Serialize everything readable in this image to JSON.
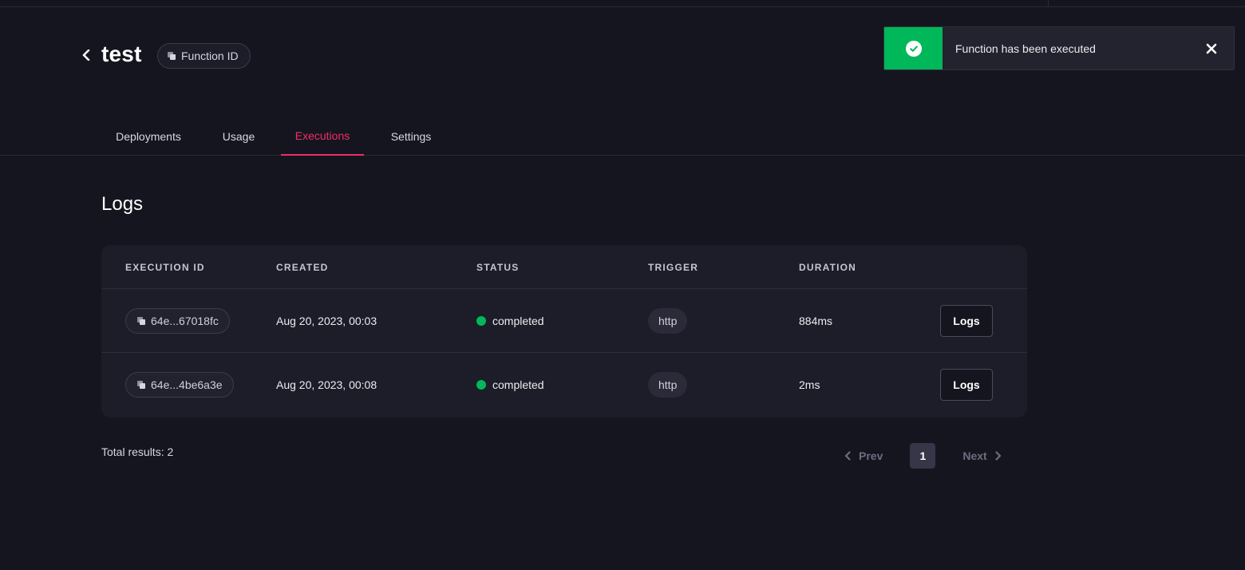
{
  "header": {
    "back_icon": "chevron-left-icon",
    "title": "test",
    "id_pill_label": "Function ID"
  },
  "toast": {
    "message": "Function has been executed",
    "status_color": "#00b85a",
    "icon": "check-circle-icon",
    "close_icon": "close-icon"
  },
  "tabs": [
    {
      "label": "Deployments",
      "active": false
    },
    {
      "label": "Usage",
      "active": false
    },
    {
      "label": "Executions",
      "active": true
    },
    {
      "label": "Settings",
      "active": false
    }
  ],
  "accent_color": "#f02e65",
  "section": {
    "title": "Logs"
  },
  "table": {
    "columns": [
      "EXECUTION ID",
      "CREATED",
      "STATUS",
      "TRIGGER",
      "DURATION"
    ],
    "rows": [
      {
        "execution_id": "64e...67018fc",
        "created": "Aug 20, 2023, 00:03",
        "status": "completed",
        "trigger": "http",
        "duration": "884ms",
        "action": "Logs"
      },
      {
        "execution_id": "64e...4be6a3e",
        "created": "Aug 20, 2023, 00:08",
        "status": "completed",
        "trigger": "http",
        "duration": "2ms",
        "action": "Logs"
      }
    ]
  },
  "footer": {
    "total_results": "Total results: 2",
    "pagination": {
      "prev_label": "Prev",
      "current_page": "1",
      "next_label": "Next"
    }
  }
}
